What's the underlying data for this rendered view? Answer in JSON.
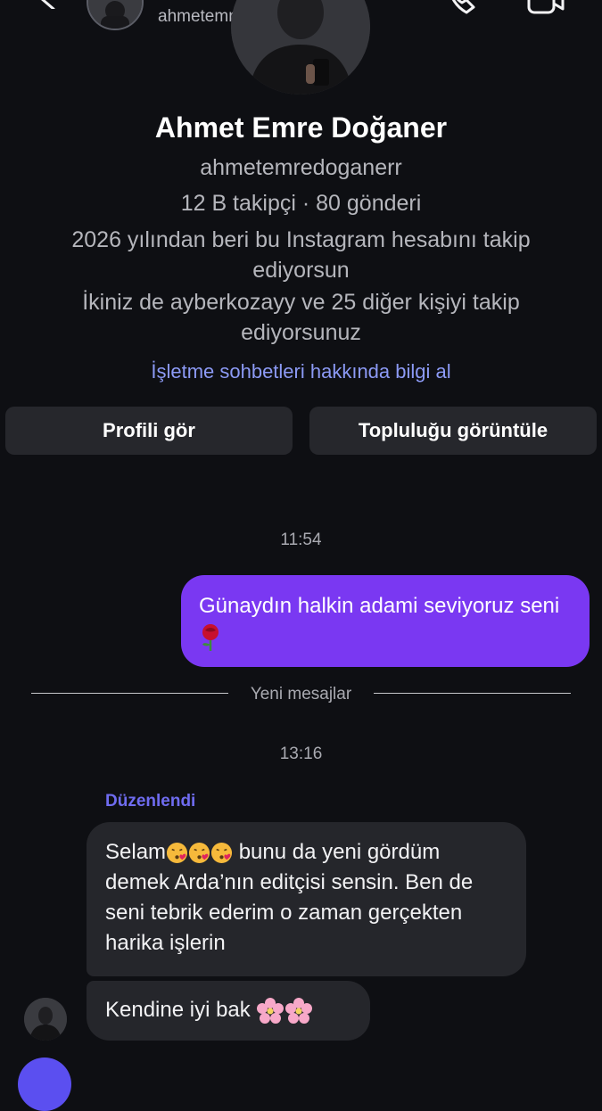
{
  "header": {
    "username": "ahmetemredoganerr"
  },
  "profile": {
    "name": "Ahmet Emre Doğaner",
    "handle": "ahmetemredoganerr",
    "stats": "12 B takipçi · 80 gönderi",
    "follow_since": "2026 yılından beri bu Instagram hesabını takip ediyorsun",
    "mutual": "İkiniz de ayberkozayy ve 25 diğer kişiyi takip ediyorsunuz",
    "business_link": "İşletme sohbetleri hakkında bilgi al",
    "view_profile_label": "Profili gör",
    "view_community_label": "Topluluğu görüntüle"
  },
  "chat": {
    "timestamp_1": "11:54",
    "sent_message": "Günaydın halkin adami seviyoruz seni",
    "sent_message_emoji": "rose-emoji",
    "new_messages_label": "Yeni mesajlar",
    "timestamp_2": "13:16",
    "edited_label": "Düzenlendi",
    "received_1_prefix": "Selam",
    "received_1_emojis": [
      "kissing-face-emoji",
      "kissing-face-emoji",
      "kissing-face-emoji"
    ],
    "received_1_text": "bunu da yeni gördüm demek Arda’nın editçisi sensin. Ben de seni tebrik ederim o zaman gerçekten harika işlerin",
    "received_2_text": "Kendine iyi bak",
    "received_2_emojis": [
      "cherry-blossom-emoji",
      "cherry-blossom-emoji"
    ]
  },
  "colors": {
    "background": "#0e0f13",
    "sent_bubble": "#7a38f2",
    "received_bubble": "#25262b",
    "link": "#8c9af5",
    "edited": "#6f6cf0",
    "button": "#26272c"
  }
}
